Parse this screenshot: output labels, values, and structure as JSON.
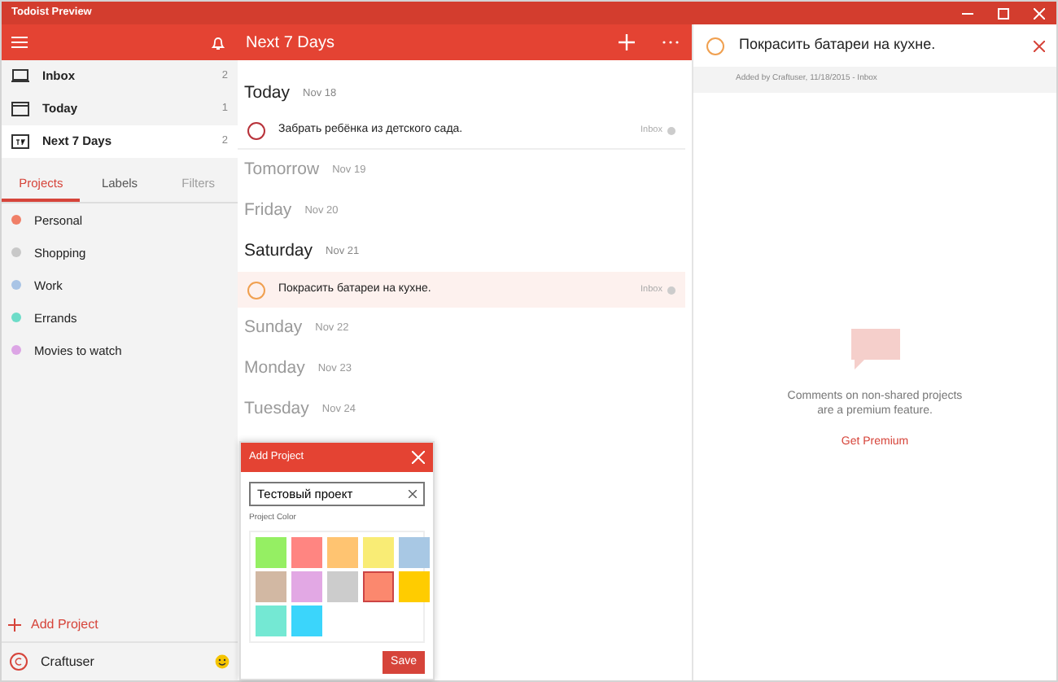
{
  "window": {
    "title": "Todoist Preview"
  },
  "header": {
    "title": "Next 7 Days"
  },
  "sidebar": {
    "filters": [
      {
        "label": "Inbox",
        "count": "2",
        "selected": false
      },
      {
        "label": "Today",
        "count": "1",
        "selected": false
      },
      {
        "label": "Next 7 Days",
        "count": "2",
        "selected": true
      }
    ],
    "tabs": [
      {
        "label": "Projects",
        "selected": true,
        "disabled": false
      },
      {
        "label": "Labels",
        "selected": false,
        "disabled": false
      },
      {
        "label": "Filters",
        "selected": false,
        "disabled": true
      }
    ],
    "projects": [
      {
        "name": "Personal",
        "color": "#f07f67"
      },
      {
        "name": "Shopping",
        "color": "#c8c8c8"
      },
      {
        "name": "Work",
        "color": "#a9c4e5"
      },
      {
        "name": "Errands",
        "color": "#6ddcc8"
      },
      {
        "name": "Movies to watch",
        "color": "#dca5e5"
      }
    ],
    "add_project": "Add Project",
    "user": {
      "name": "Craftuser"
    }
  },
  "days": [
    {
      "name": "Today",
      "date": "Nov 18",
      "tasks": [
        {
          "text": "Забрать ребёнка из детского сада.",
          "project": "Inbox",
          "color": "#b8323a",
          "selected": false
        }
      ]
    },
    {
      "name": "Tomorrow",
      "date": "Nov 19"
    },
    {
      "name": "Friday",
      "date": "Nov 20"
    },
    {
      "name": "Saturday",
      "date": "Nov 21",
      "tasks": [
        {
          "text": "Покрасить батареи на кухне.",
          "project": "Inbox",
          "color": "#f0a050",
          "selected": true
        }
      ]
    },
    {
      "name": "Sunday",
      "date": "Nov 22"
    },
    {
      "name": "Monday",
      "date": "Nov 23"
    },
    {
      "name": "Tuesday",
      "date": "Nov 24"
    }
  ],
  "dialog": {
    "title": "Add Project",
    "value": "Тестовый проект",
    "color_label": "Project Color",
    "save": "Save",
    "colors": [
      {
        "color": "#95ef63",
        "selected": false
      },
      {
        "color": "#ff8581",
        "selected": false
      },
      {
        "color": "#ffc471",
        "selected": false
      },
      {
        "color": "#f9ec75",
        "selected": false
      },
      {
        "color": "#a8c8e4",
        "selected": false
      },
      {
        "color": "#d2b8a3",
        "selected": false
      },
      {
        "color": "#e2a8e4",
        "selected": false
      },
      {
        "color": "#cccccc",
        "selected": false
      },
      {
        "color": "#fb886e",
        "selected": true
      },
      {
        "color": "#ffcc00",
        "selected": false
      },
      {
        "color": "#74e8d3",
        "selected": false
      },
      {
        "color": "#3bd5fb",
        "selected": false
      }
    ]
  },
  "detail": {
    "task": "Покрасить батареи на кухне.",
    "color": "#f0a050",
    "meta": "Added by Craftuser, 11/18/2015 -  Inbox",
    "note": "Comments on non-shared projects are a premium feature.",
    "link": "Get Premium"
  }
}
